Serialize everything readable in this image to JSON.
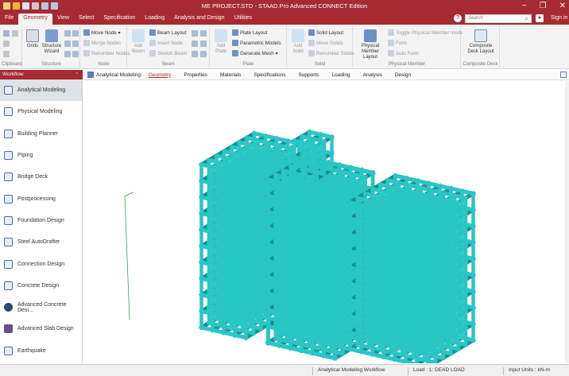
{
  "window": {
    "title": "ME PROJECT.STD - STAAD.Pro Advanced CONNECT Edition",
    "controls": [
      "−",
      "❐",
      "✕"
    ]
  },
  "menu": {
    "items": [
      "File",
      "Geometry",
      "View",
      "Select",
      "Specification",
      "Loading",
      "Analysis and Design",
      "Utilities"
    ],
    "active": "Geometry",
    "search_placeholder": "Search",
    "sign_in": "Sign in"
  },
  "ribbon": {
    "clipboard": {
      "label": "Clipboard"
    },
    "structure": {
      "label": "Structure",
      "grids": "Grids",
      "wizard": "Structure Wizard"
    },
    "node": {
      "label": "Node",
      "move": "Move Node",
      "merge": "Merge Nodes",
      "renumber": "Renumber Nodes"
    },
    "beam": {
      "label": "Beam",
      "add": "Add Beam",
      "layout": "Beam Layout",
      "insert": "Insert Node",
      "stretch": "Stretch Beam"
    },
    "plate": {
      "label": "Plate",
      "add": "Add Plate",
      "layout": "Plate Layout",
      "parametric": "Parametric Models",
      "mesh": "Generate Mesh"
    },
    "solid": {
      "label": "Solid",
      "add": "Add Solid",
      "layout": "Solid Layout",
      "move": "Move Solids",
      "renumber": "Renumber Solids"
    },
    "physical": {
      "label": "Physical Member",
      "layout": "Physical Member Layout",
      "toggle": "Toggle Physical Member mode",
      "form": "Form",
      "auto_form": "Auto Form"
    },
    "composite": {
      "label": "Composite Deck",
      "layout": "Composite Deck Layout"
    }
  },
  "pagebar": {
    "label": "Analytical Modeling:",
    "tabs": [
      "Geometry",
      "Properties",
      "Materials",
      "Specifications",
      "Supports",
      "Loading",
      "Analysis",
      "Design"
    ],
    "active": "Geometry"
  },
  "workflow": {
    "title": "Workflow",
    "items": [
      "Analytical Modeling",
      "Physical Modeling",
      "Building Planner",
      "Piping",
      "Bridge Deck",
      "Postprocessing",
      "Foundation Design",
      "Steel AutoDrafter",
      "Connection Design",
      "Concrete Design",
      "Advanced Concrete Desi...",
      "Advanced Slab Design",
      "Earthquake"
    ],
    "active": "Analytical Modeling"
  },
  "status": {
    "workflow": "Analytical Modeling Workflow",
    "load": "Load : 1: DEAD LOAD",
    "units": "Input Units : kN-m"
  },
  "colors": {
    "brand": "#a52a32",
    "model": "#29c6c6",
    "model_dark": "#178f8f"
  }
}
